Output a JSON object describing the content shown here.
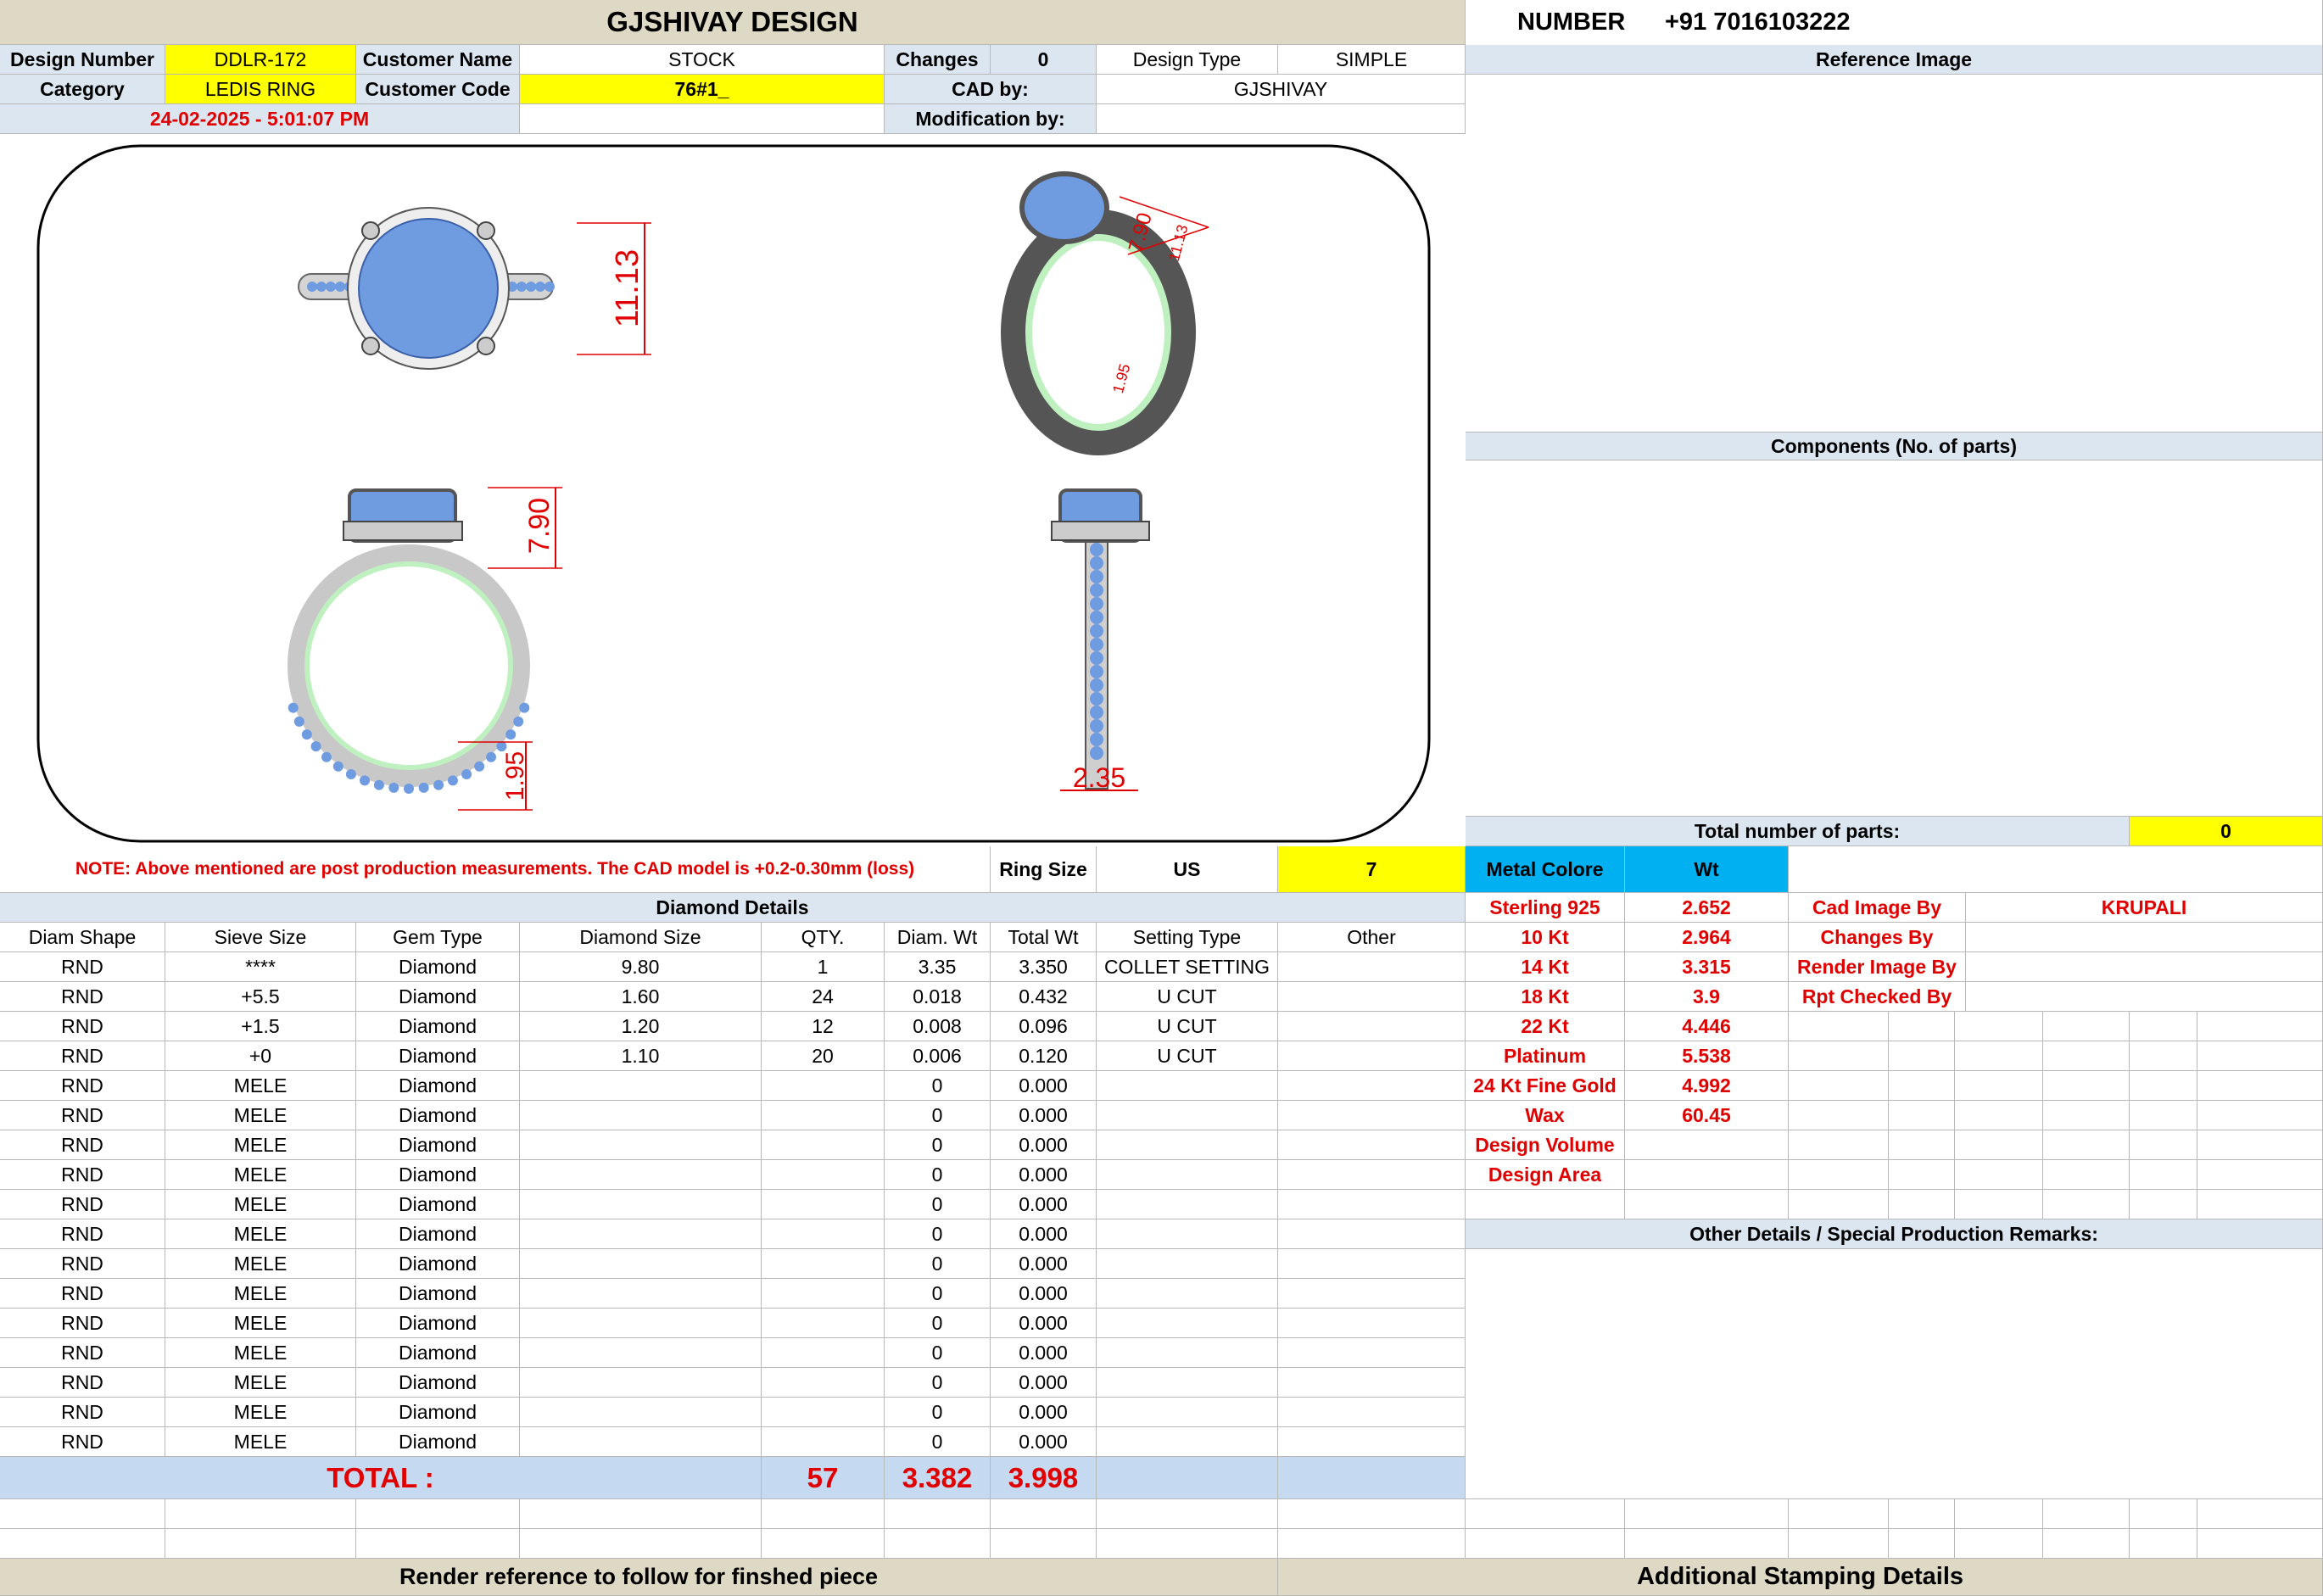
{
  "company": {
    "name": "GJSHIVAY DESIGN",
    "number_label": "NUMBER",
    "phone": "+91 7016103222"
  },
  "header": {
    "design_number_label": "Design Number",
    "design_number": "DDLR-172",
    "customer_name_label": "Customer Name",
    "customer_name": "STOCK",
    "changes_label": "Changes",
    "changes": "0",
    "design_type_label": "Design Type",
    "design_type": "SIMPLE",
    "category_label": "Category",
    "category": "LEDIS RING",
    "customer_code_label": "Customer Code",
    "customer_code": "76#1_",
    "cad_by_label": "CAD by:",
    "cad_by": "GJSHIVAY",
    "timestamp": "24-02-2025 - 5:01:07 PM",
    "modification_label": "Modification by:",
    "modification": ""
  },
  "cad": {
    "dims": {
      "top_height": "11.13",
      "iso_a": "7.90",
      "iso_b": "11.13",
      "iso_c": "1.95",
      "front_height": "7.90",
      "front_band": "1.95",
      "side_width": "2.35"
    },
    "colors": {
      "gem": "#6f9be0",
      "metal": "#d4d4d4",
      "inner": "#bff0bf",
      "dim": "#e00000"
    }
  },
  "right_panel": {
    "reference_image_label": "Reference Image",
    "components_label": "Components (No. of parts)",
    "total_parts_label": "Total number of parts:",
    "total_parts": "0",
    "other_details_label": "Other Details / Special Production Remarks:"
  },
  "note": {
    "text": "NOTE: Above mentioned are post production measurements. The CAD model is +0.2-0.30mm (loss)",
    "ring_size_label": "Ring Size",
    "ring_size_unit": "US",
    "ring_size": "7"
  },
  "metal": {
    "col_label": "Metal Colore",
    "wt_label": "Wt",
    "rows": [
      {
        "name": "Sterling 925",
        "wt": "2.652"
      },
      {
        "name": "10 Kt",
        "wt": "2.964"
      },
      {
        "name": "14 Kt",
        "wt": "3.315"
      },
      {
        "name": "18 Kt",
        "wt": "3.9"
      },
      {
        "name": "22 Kt",
        "wt": "4.446"
      },
      {
        "name": "Platinum",
        "wt": "5.538"
      },
      {
        "name": "24 Kt Fine Gold",
        "wt": "4.992"
      },
      {
        "name": "Wax",
        "wt": "60.45"
      },
      {
        "name": "Design Volume",
        "wt": ""
      },
      {
        "name": "Design Area",
        "wt": ""
      }
    ]
  },
  "credits": {
    "rows": [
      {
        "label": "Cad Image By",
        "value": "KRUPALI"
      },
      {
        "label": "Changes By",
        "value": ""
      },
      {
        "label": "Render Image By",
        "value": ""
      },
      {
        "label": "Rpt Checked By",
        "value": ""
      }
    ]
  },
  "diamonds": {
    "title": "Diamond Details",
    "columns": [
      "Diam Shape",
      "Sieve Size",
      "Gem Type",
      "Diamond Size",
      "QTY.",
      "Diam. Wt",
      "Total Wt",
      "Setting Type",
      "Other"
    ],
    "rows": [
      [
        "RND",
        "****",
        "Diamond",
        "9.80",
        "1",
        "3.35",
        "3.350",
        "COLLET SETTING",
        ""
      ],
      [
        "RND",
        "+5.5",
        "Diamond",
        "1.60",
        "24",
        "0.018",
        "0.432",
        "U CUT",
        ""
      ],
      [
        "RND",
        "+1.5",
        "Diamond",
        "1.20",
        "12",
        "0.008",
        "0.096",
        "U CUT",
        ""
      ],
      [
        "RND",
        "+0",
        "Diamond",
        "1.10",
        "20",
        "0.006",
        "0.120",
        "U CUT",
        ""
      ],
      [
        "RND",
        "MELE",
        "Diamond",
        "",
        "",
        "0",
        "0.000",
        "",
        ""
      ],
      [
        "RND",
        "MELE",
        "Diamond",
        "",
        "",
        "0",
        "0.000",
        "",
        ""
      ],
      [
        "RND",
        "MELE",
        "Diamond",
        "",
        "",
        "0",
        "0.000",
        "",
        ""
      ],
      [
        "RND",
        "MELE",
        "Diamond",
        "",
        "",
        "0",
        "0.000",
        "",
        ""
      ],
      [
        "RND",
        "MELE",
        "Diamond",
        "",
        "",
        "0",
        "0.000",
        "",
        ""
      ],
      [
        "RND",
        "MELE",
        "Diamond",
        "",
        "",
        "0",
        "0.000",
        "",
        ""
      ],
      [
        "RND",
        "MELE",
        "Diamond",
        "",
        "",
        "0",
        "0.000",
        "",
        ""
      ],
      [
        "RND",
        "MELE",
        "Diamond",
        "",
        "",
        "0",
        "0.000",
        "",
        ""
      ],
      [
        "RND",
        "MELE",
        "Diamond",
        "",
        "",
        "0",
        "0.000",
        "",
        ""
      ],
      [
        "RND",
        "MELE",
        "Diamond",
        "",
        "",
        "0",
        "0.000",
        "",
        ""
      ],
      [
        "RND",
        "MELE",
        "Diamond",
        "",
        "",
        "0",
        "0.000",
        "",
        ""
      ],
      [
        "RND",
        "MELE",
        "Diamond",
        "",
        "",
        "0",
        "0.000",
        "",
        ""
      ],
      [
        "RND",
        "MELE",
        "Diamond",
        "",
        "",
        "0",
        "0.000",
        "",
        ""
      ]
    ],
    "total_label": "TOTAL :",
    "total_qty": "57",
    "total_diam_wt": "3.382",
    "total_wt": "3.998"
  },
  "footer": {
    "render_note": "Render reference to follow for finshed piece",
    "stamping": "Additional Stamping Details"
  }
}
